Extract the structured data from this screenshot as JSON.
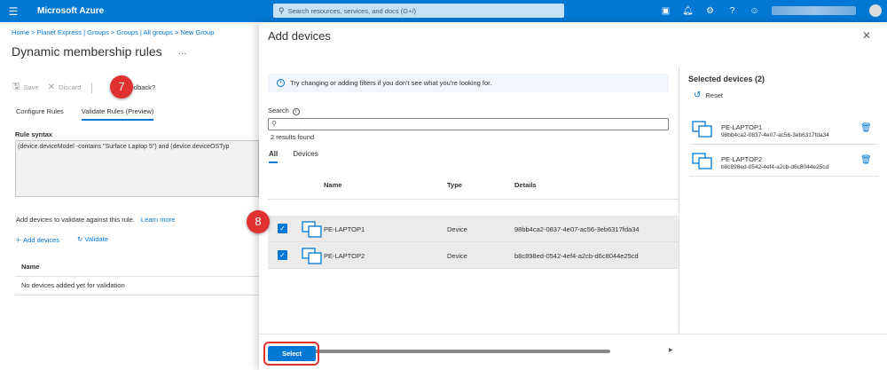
{
  "topbar": {
    "brand": "Microsoft Azure",
    "search_placeholder": "Search resources, services, and docs (G+/)",
    "menu_icon": "hamburger-icon",
    "icons": [
      "cloud-shell-icon",
      "bell-icon",
      "gear-icon",
      "help-icon",
      "feedback-icon"
    ]
  },
  "background_page": {
    "breadcrumb": "Home > Planet Express | Groups > Groups | All groups > New Group",
    "title": "Dynamic membership rules",
    "more": "···",
    "commands": {
      "save": "Save",
      "discard": "Discard",
      "feedback": "feedback?"
    },
    "tabs": [
      "Configure Rules",
      "Validate Rules (Preview)"
    ],
    "rule_syntax_label": "Rule syntax",
    "rule_syntax": "(device.deviceModel -contains \"Surface Laptop 5\") and (device.deviceOSTyp",
    "add_devices_text": "Add devices to validate against this rule.",
    "learn_more": "Learn more",
    "add_devices": "Add devices",
    "validate": "Validate",
    "name_header": "Name",
    "empty_row": "No devices added yet for validation"
  },
  "blade": {
    "title": "Add devices",
    "close": "✕",
    "info": "Try changing or adding filters if you don't see what you're looking for.",
    "search_label": "Search",
    "search_value": "",
    "results": "2 results found",
    "pivots": [
      "All",
      "Devices"
    ],
    "columns": {
      "name": "Name",
      "type": "Type",
      "details": "Details"
    },
    "rows": [
      {
        "name": "PE-LAPTOP1",
        "type": "Device",
        "details": "98bb4ca2-0837-4e07-ac56-3eb6317fda34"
      },
      {
        "name": "PE-LAPTOP2",
        "type": "Device",
        "details": "b8c898ed-0542-4ef4-a2cb-d6c8044e25cd"
      }
    ],
    "selected": {
      "title": "Selected devices (2)",
      "reset": "Reset",
      "items": [
        {
          "name": "PE-LAPTOP1",
          "id": "98bb4ca2-0837-4e07-ac56-3eb6317fda34"
        },
        {
          "name": "PE-LAPTOP2",
          "id": "b8c898ed-0542-4ef4-a2cb-d6c8044e25cd"
        }
      ]
    },
    "select_button": "Select"
  },
  "markers": {
    "step7": "7",
    "step8": "8"
  },
  "colors": {
    "accent": "#0078d4",
    "marker": "#e03131"
  }
}
